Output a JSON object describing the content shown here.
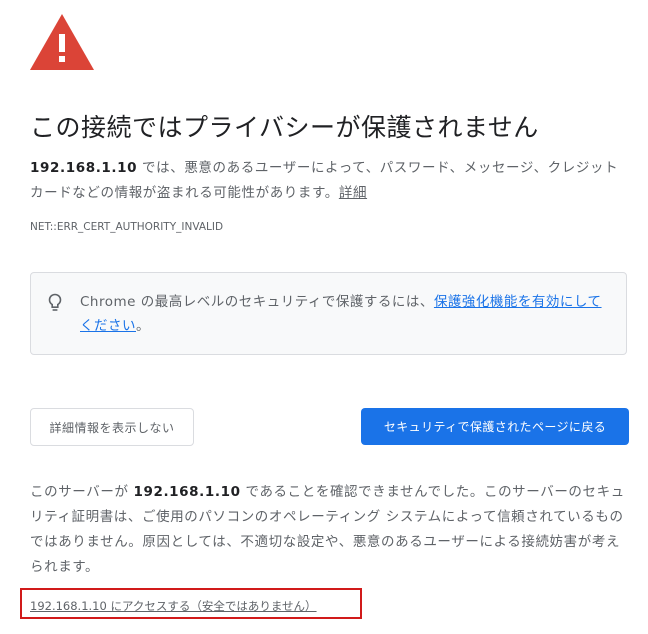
{
  "page": {
    "title": "この接続ではプライバシーが保護されません",
    "intro": {
      "host": "192.168.1.10",
      "text": " では、悪意のあるユーザーによって、パスワード、メッセージ、クレジット カードなどの情報が盗まれる可能性があります。",
      "link": "詳細"
    },
    "error_code": "NET::ERR_CERT_AUTHORITY_INVALID"
  },
  "tip": {
    "icon": "lightbulb-icon",
    "text": "Chrome の最高レベルのセキュリティで保護するには、",
    "link": "保護強化機能を有効にしてください",
    "suffix": "。"
  },
  "buttons": {
    "details_label": "詳細情報を表示しない",
    "back_label": "セキュリティで保護されたページに戻る"
  },
  "details": {
    "prefix": "このサーバーが ",
    "host": "192.168.1.10",
    "text": " であることを確認できませんでした。このサーバーのセキュリティ証明書は、ご使用のパソコンのオペレーティング システムによって信頼されているものではありません。原因としては、不適切な設定や、悪意のあるユーザーによる接続妨害が考えられます。"
  },
  "proceed": {
    "label": "192.168.1.10 にアクセスする（安全ではありません）"
  },
  "colors": {
    "warning": "#db4437",
    "primary": "#1a73e8",
    "highlight": "#d11a1a"
  }
}
